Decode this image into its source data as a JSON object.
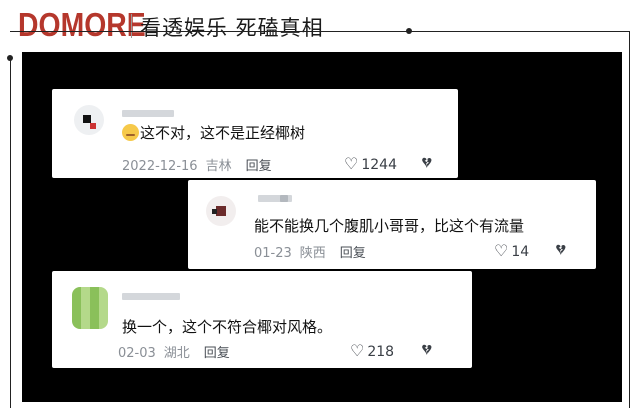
{
  "header": {
    "logo": "DOMORE",
    "tagline": "看透娱乐 死磕真相"
  },
  "comments": [
    {
      "text": "这不对，这不是正经椰树",
      "date": "2022-12-16",
      "location": "吉林",
      "reply_label": "回复",
      "likes": "1244",
      "has_emoji": true
    },
    {
      "text": "能不能换几个腹肌小哥哥，比这个有流量",
      "date": "01-23",
      "location": "陕西",
      "reply_label": "回复",
      "likes": "14"
    },
    {
      "text": "换一个，这个不符合椰对风格。",
      "date": "02-03",
      "location": "湖北",
      "reply_label": "回复",
      "likes": "218"
    }
  ],
  "icons": {
    "like": "heart-icon",
    "dislike": "broken-heart-icon",
    "emoji": "face-emoji-icon"
  },
  "colors": {
    "brand": "#b5372c",
    "panel": "#000000",
    "card": "#ffffff"
  }
}
